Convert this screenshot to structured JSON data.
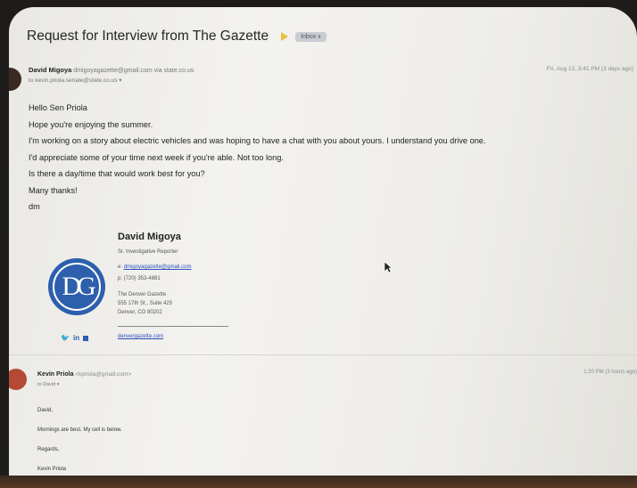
{
  "email": {
    "subject": "Request for Interview from The Gazette",
    "label": "Inbox x",
    "message1": {
      "sender_name": "David Migoya",
      "sender_email": "dmigoyagazette@gmail.com via state.co.us",
      "to": "to kevin.priola.senate@state.co.us",
      "date": "Fri, Aug 12, 3:41 PM (3 days ago)",
      "greeting": "Hello Sen Priola",
      "line1": "Hope you're enjoying the summer.",
      "line2": "I'm working on a story about electric vehicles and was hoping to have a chat with you about yours. I understand you drive one.",
      "line3": "I'd appreciate some of your time next week if you're able. Not too long.",
      "line4": "Is there a day/time that would work best for you?",
      "signoff": "Many thanks!",
      "initials": "dm"
    },
    "signature": {
      "logo_text": "DG",
      "name": "David Migoya",
      "title": "Sr. Investigative Reporter",
      "email_prefix": "e:",
      "email": "dmigoyagazette@gmail.com",
      "phone": "p: (720) 353-4881",
      "org": "The Denver Gazette",
      "street": "555 17th St., Suite 425",
      "city": "Denver, CO 80202",
      "social": "in",
      "website": "denvergazette.com"
    },
    "message2": {
      "sender_name": "Kevin Priola",
      "sender_email": "<kpriola@gmail.com>",
      "to": "to David",
      "date": "1:20 PM (3 hours ago)",
      "line1": "David,",
      "line2": "Mornings are best. My cell is below.",
      "line3": "Regards,",
      "line4": "Kevin Priola"
    }
  }
}
